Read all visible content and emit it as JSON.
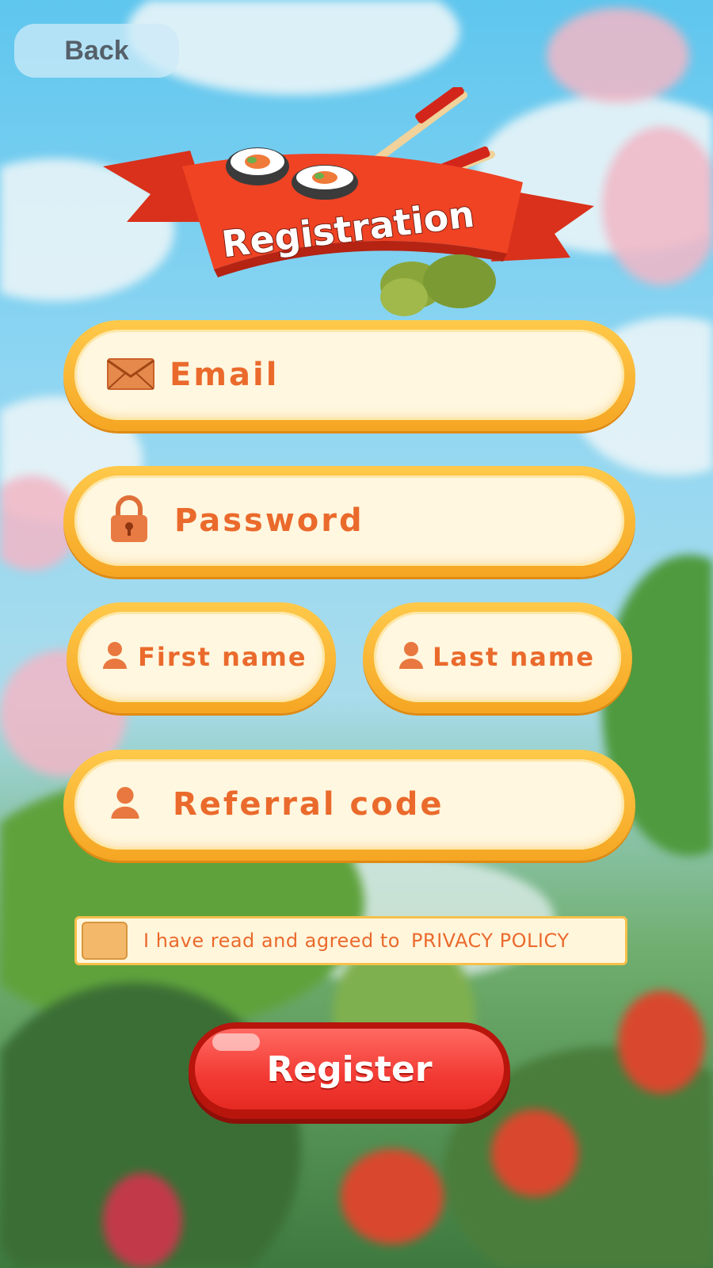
{
  "header": {
    "back_label": "Back",
    "banner_title": "Registration"
  },
  "form": {
    "email": {
      "label": "Email",
      "icon": "envelope-icon"
    },
    "password": {
      "label": "Password",
      "icon": "lock-icon"
    },
    "first_name": {
      "label": "First name",
      "icon": "user-icon"
    },
    "last_name": {
      "label": "Last name",
      "icon": "user-icon"
    },
    "referral": {
      "label": "Referral code",
      "icon": "user-icon"
    },
    "agree_text": "I have read and agreed to",
    "policy_link": "PRIVACY POLICY",
    "register_label": "Register"
  },
  "colors": {
    "accent": "#ea6a2c",
    "field_border": "#f5a623",
    "field_fill": "#fff7df",
    "button_red": "#f23a33",
    "banner_red": "#e8391f"
  }
}
